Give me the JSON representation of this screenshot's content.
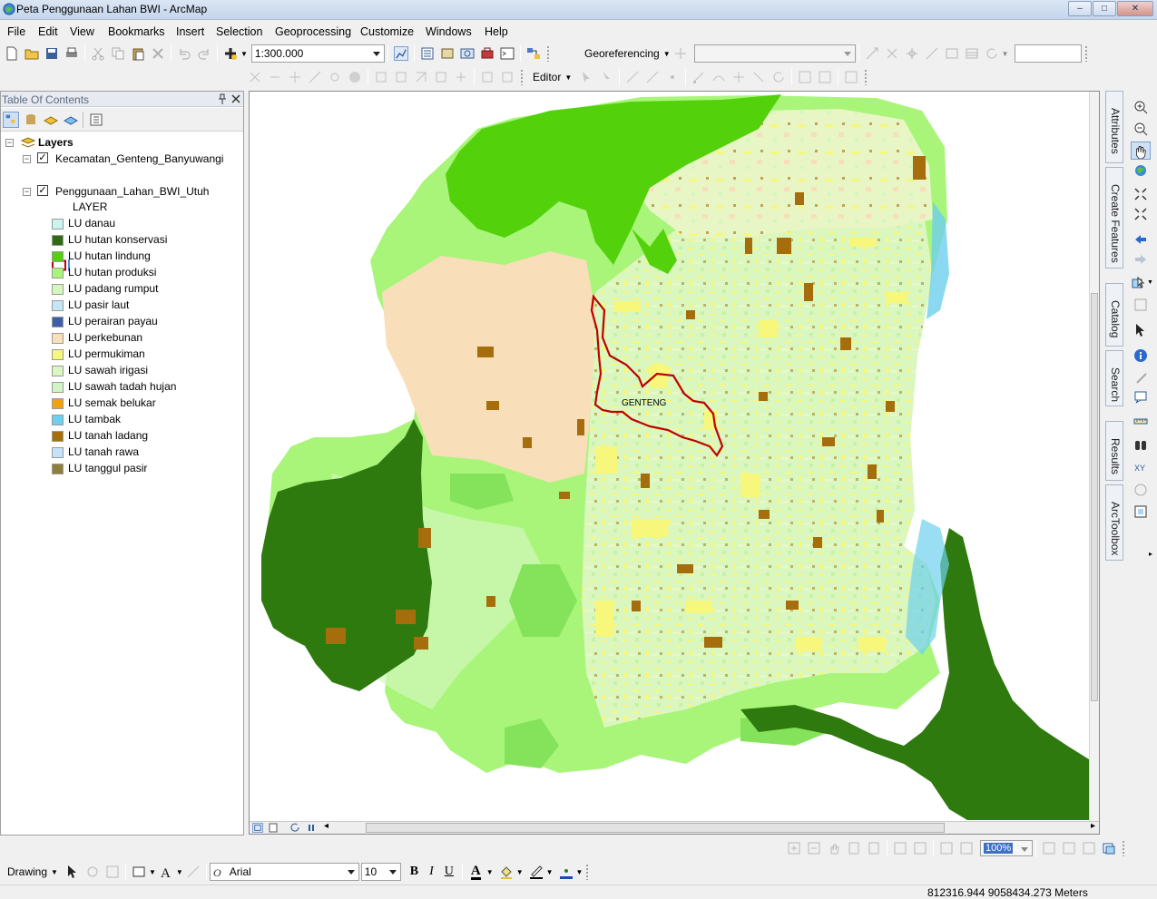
{
  "window": {
    "title": "Peta Penggunaan Lahan BWI - ArcMap",
    "controls": [
      "–",
      "□",
      "✕"
    ]
  },
  "menu": [
    "File",
    "Edit",
    "View",
    "Bookmarks",
    "Insert",
    "Selection",
    "Geoprocessing",
    "Customize",
    "Windows",
    "Help"
  ],
  "standard_toolbar": {
    "scale_value": "1:300.000",
    "georeferencing_label": "Georeferencing",
    "georef_layer_value": "",
    "rotation_value": ""
  },
  "editor_toolbar": {
    "editor_label": "Editor"
  },
  "toc": {
    "title": "Table Of Contents",
    "root_label": "Layers",
    "layers": [
      {
        "name": "Kecamatan_Genteng_Banyuwangi",
        "checked": true
      },
      {
        "name": "Penggunaan_Lahan_BWI_Utuh",
        "checked": true,
        "field_label": "LAYER"
      }
    ],
    "legend": [
      {
        "label": "LU danau",
        "color": "#c9f5ee"
      },
      {
        "label": "LU hutan konservasi",
        "color": "#2e6b12"
      },
      {
        "label": "LU hutan lindung",
        "color": "#53d10b"
      },
      {
        "label": "LU hutan produksi",
        "color": "#a8f57a"
      },
      {
        "label": "LU padang rumput",
        "color": "#d3f8bd"
      },
      {
        "label": "LU pasir laut",
        "color": "#c5e6f8"
      },
      {
        "label": "LU perairan payau",
        "color": "#3d5fa8"
      },
      {
        "label": "LU perkebunan",
        "color": "#f8dfb9"
      },
      {
        "label": "LU permukiman",
        "color": "#f7f77c"
      },
      {
        "label": "LU sawah irigasi",
        "color": "#d9f7be"
      },
      {
        "label": "LU sawah tadah hujan",
        "color": "#d0f5c5"
      },
      {
        "label": "LU semak belukar",
        "color": "#f2a20e"
      },
      {
        "label": "LU tambak",
        "color": "#6ed0ee"
      },
      {
        "label": "LU tanah ladang",
        "color": "#a66d0c"
      },
      {
        "label": "LU tanah rawa",
        "color": "#c4e3f8"
      },
      {
        "label": "LU tanggul pasir",
        "color": "#8d7e3c"
      }
    ]
  },
  "map": {
    "district_label": "GENTENG",
    "boundary_color": "#c00000"
  },
  "dock_tabs": [
    "Attributes",
    "Create Features",
    "Catalog",
    "Search",
    "Results",
    "ArcToolbox"
  ],
  "layout_toolbar": {
    "zoom_percent": "100%"
  },
  "drawing_toolbar": {
    "drawing_label": "Drawing",
    "font_name": "Arial",
    "font_size": "10",
    "bold": "B",
    "italic": "I",
    "underline": "U",
    "text_color_glyph": "A"
  },
  "status": {
    "coordinates": "812316.944  9058434.273 Meters"
  }
}
